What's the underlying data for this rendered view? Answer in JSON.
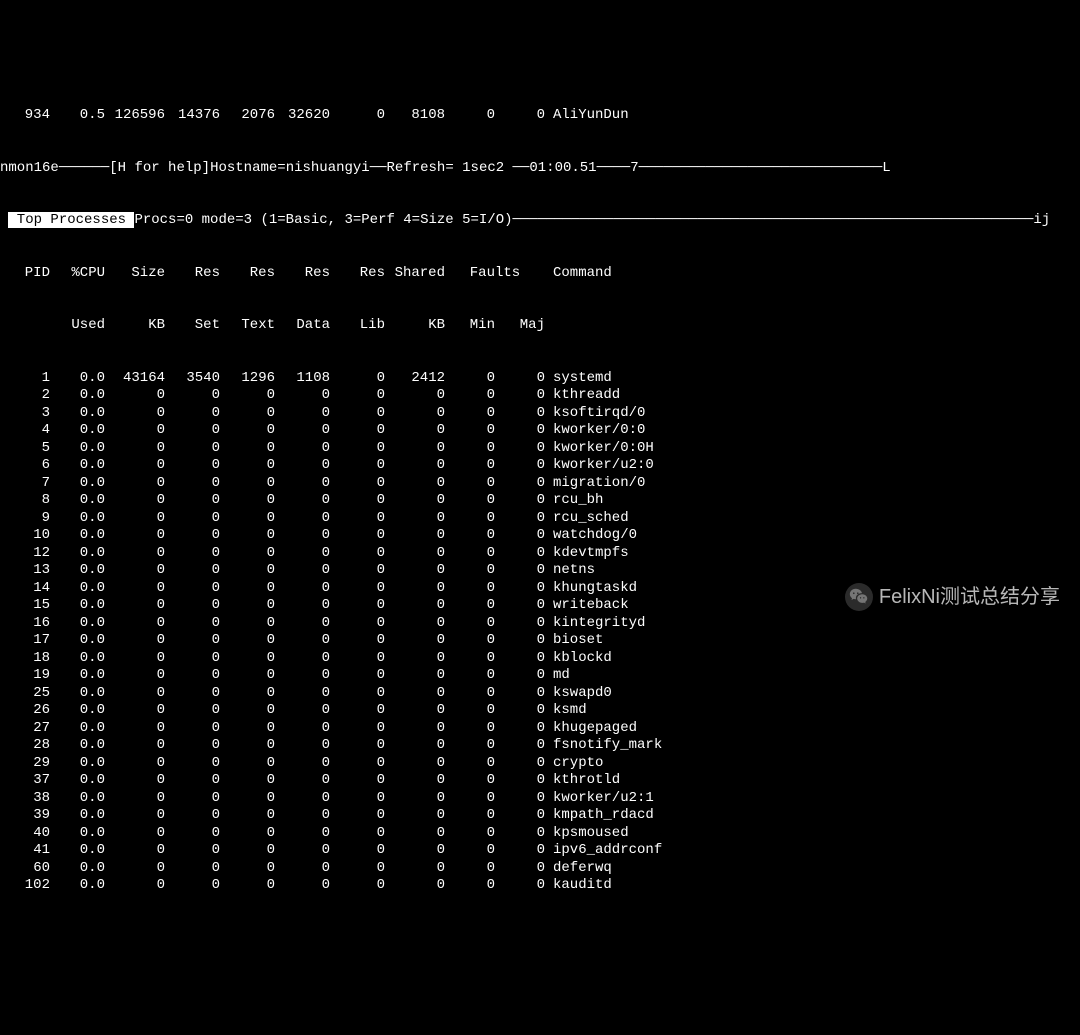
{
  "top": {
    "pid": "934",
    "cpu": "0.5",
    "size": "126596",
    "res1": "14376",
    "res2": "2076",
    "res3": "32620",
    "res4": "0",
    "shared": "8108",
    "min": "0",
    "maj": "0",
    "cmd": "AliYunDun"
  },
  "info1": {
    "prefix": "nmon16e",
    "help": "[H for help]",
    "hostname_label": "Hostname=",
    "hostname": "nishuangyi",
    "refresh_label": "Refresh=",
    "refresh": " 1sec",
    "extra": "2",
    "time": "01:00.51",
    "right": "7",
    "end": "L"
  },
  "info2": {
    "title": " Top Processes ",
    "procs": "Procs=0 mode=3 (1=Basic, 3=Perf 4=Size 5=I/O)",
    "end": "ij"
  },
  "headers": {
    "row1": [
      "PID",
      "%CPU",
      "Size",
      "Res",
      "Res",
      "Res",
      "Res",
      "Shared",
      "Faults",
      "Command"
    ],
    "row2": [
      "",
      "Used",
      "KB",
      "Set",
      "Text",
      "Data",
      "Lib",
      "KB",
      "Min",
      "Maj",
      ""
    ]
  },
  "processes": [
    {
      "pid": "1",
      "cpu": "0.0",
      "size": "43164",
      "res1": "3540",
      "res2": "1296",
      "res3": "1108",
      "res4": "0",
      "shared": "2412",
      "min": "0",
      "maj": "0",
      "cmd": "systemd"
    },
    {
      "pid": "2",
      "cpu": "0.0",
      "size": "0",
      "res1": "0",
      "res2": "0",
      "res3": "0",
      "res4": "0",
      "shared": "0",
      "min": "0",
      "maj": "0",
      "cmd": "kthreadd"
    },
    {
      "pid": "3",
      "cpu": "0.0",
      "size": "0",
      "res1": "0",
      "res2": "0",
      "res3": "0",
      "res4": "0",
      "shared": "0",
      "min": "0",
      "maj": "0",
      "cmd": "ksoftirqd/0"
    },
    {
      "pid": "4",
      "cpu": "0.0",
      "size": "0",
      "res1": "0",
      "res2": "0",
      "res3": "0",
      "res4": "0",
      "shared": "0",
      "min": "0",
      "maj": "0",
      "cmd": "kworker/0:0"
    },
    {
      "pid": "5",
      "cpu": "0.0",
      "size": "0",
      "res1": "0",
      "res2": "0",
      "res3": "0",
      "res4": "0",
      "shared": "0",
      "min": "0",
      "maj": "0",
      "cmd": "kworker/0:0H"
    },
    {
      "pid": "6",
      "cpu": "0.0",
      "size": "0",
      "res1": "0",
      "res2": "0",
      "res3": "0",
      "res4": "0",
      "shared": "0",
      "min": "0",
      "maj": "0",
      "cmd": "kworker/u2:0"
    },
    {
      "pid": "7",
      "cpu": "0.0",
      "size": "0",
      "res1": "0",
      "res2": "0",
      "res3": "0",
      "res4": "0",
      "shared": "0",
      "min": "0",
      "maj": "0",
      "cmd": "migration/0"
    },
    {
      "pid": "8",
      "cpu": "0.0",
      "size": "0",
      "res1": "0",
      "res2": "0",
      "res3": "0",
      "res4": "0",
      "shared": "0",
      "min": "0",
      "maj": "0",
      "cmd": "rcu_bh"
    },
    {
      "pid": "9",
      "cpu": "0.0",
      "size": "0",
      "res1": "0",
      "res2": "0",
      "res3": "0",
      "res4": "0",
      "shared": "0",
      "min": "0",
      "maj": "0",
      "cmd": "rcu_sched"
    },
    {
      "pid": "10",
      "cpu": "0.0",
      "size": "0",
      "res1": "0",
      "res2": "0",
      "res3": "0",
      "res4": "0",
      "shared": "0",
      "min": "0",
      "maj": "0",
      "cmd": "watchdog/0"
    },
    {
      "pid": "12",
      "cpu": "0.0",
      "size": "0",
      "res1": "0",
      "res2": "0",
      "res3": "0",
      "res4": "0",
      "shared": "0",
      "min": "0",
      "maj": "0",
      "cmd": "kdevtmpfs"
    },
    {
      "pid": "13",
      "cpu": "0.0",
      "size": "0",
      "res1": "0",
      "res2": "0",
      "res3": "0",
      "res4": "0",
      "shared": "0",
      "min": "0",
      "maj": "0",
      "cmd": "netns"
    },
    {
      "pid": "14",
      "cpu": "0.0",
      "size": "0",
      "res1": "0",
      "res2": "0",
      "res3": "0",
      "res4": "0",
      "shared": "0",
      "min": "0",
      "maj": "0",
      "cmd": "khungtaskd"
    },
    {
      "pid": "15",
      "cpu": "0.0",
      "size": "0",
      "res1": "0",
      "res2": "0",
      "res3": "0",
      "res4": "0",
      "shared": "0",
      "min": "0",
      "maj": "0",
      "cmd": "writeback"
    },
    {
      "pid": "16",
      "cpu": "0.0",
      "size": "0",
      "res1": "0",
      "res2": "0",
      "res3": "0",
      "res4": "0",
      "shared": "0",
      "min": "0",
      "maj": "0",
      "cmd": "kintegrityd"
    },
    {
      "pid": "17",
      "cpu": "0.0",
      "size": "0",
      "res1": "0",
      "res2": "0",
      "res3": "0",
      "res4": "0",
      "shared": "0",
      "min": "0",
      "maj": "0",
      "cmd": "bioset"
    },
    {
      "pid": "18",
      "cpu": "0.0",
      "size": "0",
      "res1": "0",
      "res2": "0",
      "res3": "0",
      "res4": "0",
      "shared": "0",
      "min": "0",
      "maj": "0",
      "cmd": "kblockd"
    },
    {
      "pid": "19",
      "cpu": "0.0",
      "size": "0",
      "res1": "0",
      "res2": "0",
      "res3": "0",
      "res4": "0",
      "shared": "0",
      "min": "0",
      "maj": "0",
      "cmd": "md"
    },
    {
      "pid": "25",
      "cpu": "0.0",
      "size": "0",
      "res1": "0",
      "res2": "0",
      "res3": "0",
      "res4": "0",
      "shared": "0",
      "min": "0",
      "maj": "0",
      "cmd": "kswapd0"
    },
    {
      "pid": "26",
      "cpu": "0.0",
      "size": "0",
      "res1": "0",
      "res2": "0",
      "res3": "0",
      "res4": "0",
      "shared": "0",
      "min": "0",
      "maj": "0",
      "cmd": "ksmd"
    },
    {
      "pid": "27",
      "cpu": "0.0",
      "size": "0",
      "res1": "0",
      "res2": "0",
      "res3": "0",
      "res4": "0",
      "shared": "0",
      "min": "0",
      "maj": "0",
      "cmd": "khugepaged"
    },
    {
      "pid": "28",
      "cpu": "0.0",
      "size": "0",
      "res1": "0",
      "res2": "0",
      "res3": "0",
      "res4": "0",
      "shared": "0",
      "min": "0",
      "maj": "0",
      "cmd": "fsnotify_mark"
    },
    {
      "pid": "29",
      "cpu": "0.0",
      "size": "0",
      "res1": "0",
      "res2": "0",
      "res3": "0",
      "res4": "0",
      "shared": "0",
      "min": "0",
      "maj": "0",
      "cmd": "crypto"
    },
    {
      "pid": "37",
      "cpu": "0.0",
      "size": "0",
      "res1": "0",
      "res2": "0",
      "res3": "0",
      "res4": "0",
      "shared": "0",
      "min": "0",
      "maj": "0",
      "cmd": "kthrotld"
    },
    {
      "pid": "38",
      "cpu": "0.0",
      "size": "0",
      "res1": "0",
      "res2": "0",
      "res3": "0",
      "res4": "0",
      "shared": "0",
      "min": "0",
      "maj": "0",
      "cmd": "kworker/u2:1"
    },
    {
      "pid": "39",
      "cpu": "0.0",
      "size": "0",
      "res1": "0",
      "res2": "0",
      "res3": "0",
      "res4": "0",
      "shared": "0",
      "min": "0",
      "maj": "0",
      "cmd": "kmpath_rdacd"
    },
    {
      "pid": "40",
      "cpu": "0.0",
      "size": "0",
      "res1": "0",
      "res2": "0",
      "res3": "0",
      "res4": "0",
      "shared": "0",
      "min": "0",
      "maj": "0",
      "cmd": "kpsmoused"
    },
    {
      "pid": "41",
      "cpu": "0.0",
      "size": "0",
      "res1": "0",
      "res2": "0",
      "res3": "0",
      "res4": "0",
      "shared": "0",
      "min": "0",
      "maj": "0",
      "cmd": "ipv6_addrconf"
    },
    {
      "pid": "60",
      "cpu": "0.0",
      "size": "0",
      "res1": "0",
      "res2": "0",
      "res3": "0",
      "res4": "0",
      "shared": "0",
      "min": "0",
      "maj": "0",
      "cmd": "deferwq"
    },
    {
      "pid": "102",
      "cpu": "0.0",
      "size": "0",
      "res1": "0",
      "res2": "0",
      "res3": "0",
      "res4": "0",
      "shared": "0",
      "min": "0",
      "maj": "0",
      "cmd": "kauditd"
    }
  ],
  "watermark": "FelixNi测试总结分享"
}
